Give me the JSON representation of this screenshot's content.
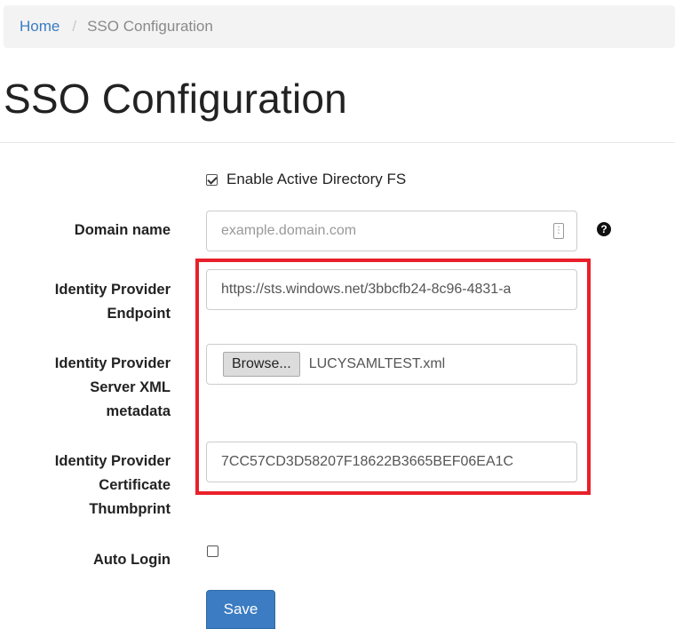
{
  "breadcrumb": {
    "home": "Home",
    "separator": "/",
    "current": "SSO Configuration"
  },
  "page_title": "SSO Configuration",
  "form": {
    "enable_adfs": {
      "label": "Enable Active Directory FS",
      "checked": true
    },
    "domain_name": {
      "label": "Domain name",
      "placeholder": "example.domain.com",
      "value": "",
      "help_icon": "question-circle-icon"
    },
    "idp_endpoint": {
      "label_line1": "Identity Provider",
      "label_line2": "Endpoint",
      "value": "https://sts.windows.net/3bbcfb24-8c96-4831-a"
    },
    "idp_metadata": {
      "label_line1": "Identity Provider",
      "label_line2": "Server XML",
      "label_line3": "metadata",
      "browse_label": "Browse...",
      "file_name": "LUCYSAMLTEST.xml"
    },
    "idp_thumbprint": {
      "label_line1": "Identity Provider",
      "label_line2": "Certificate",
      "label_line3": "Thumbprint",
      "value": "7CC57CD3D58207F18622B3665BEF06EA1C"
    },
    "auto_login": {
      "label": "Auto Login",
      "checked": false
    },
    "save_label": "Save"
  },
  "colors": {
    "link": "#3a7cc2",
    "highlight": "#e8202a",
    "primary_button": "#3b7cc2"
  }
}
